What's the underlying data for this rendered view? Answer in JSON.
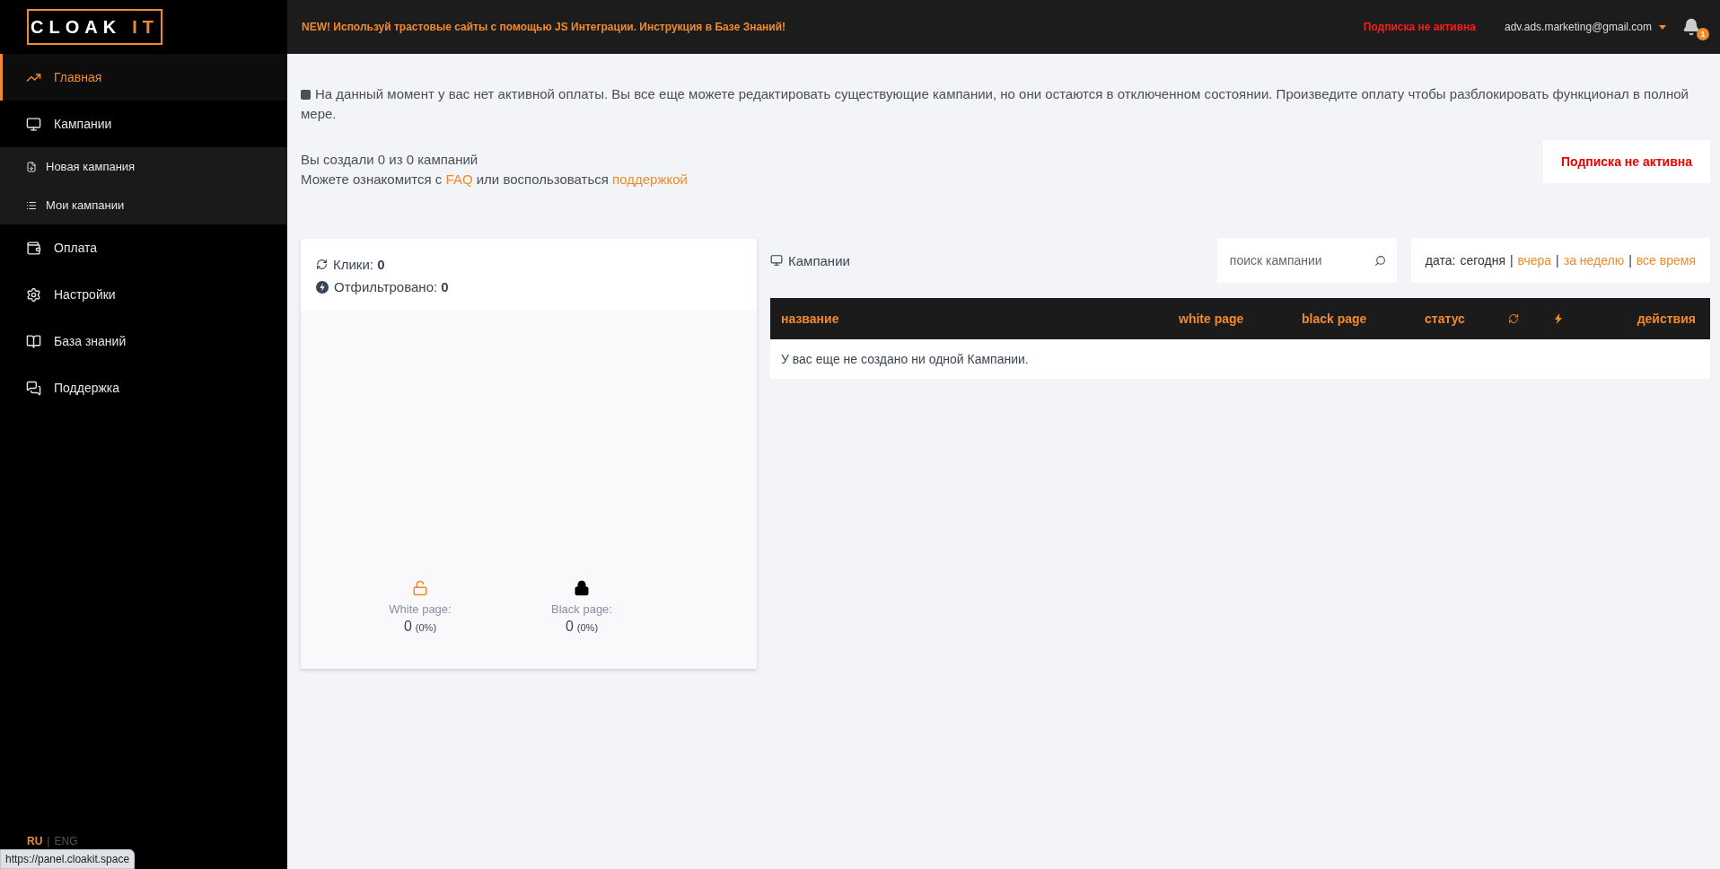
{
  "logo": {
    "word": "CLOAK",
    "accent": "IT"
  },
  "sidebar": {
    "items": [
      {
        "label": "Главная",
        "selected": true
      },
      {
        "label": "Кампании",
        "selected": false,
        "expanded": true,
        "children": [
          {
            "label": "Новая кампания",
            "selected": false
          },
          {
            "label": "Мои кампании",
            "selected": false
          }
        ]
      },
      {
        "label": "Оплата",
        "selected": false
      },
      {
        "label": "Настройки",
        "selected": false
      },
      {
        "label": "База знаний",
        "selected": false
      },
      {
        "label": "Поддержка",
        "selected": false
      }
    ],
    "languages": [
      {
        "label": "RU",
        "selected": true
      },
      {
        "label": "ENG",
        "selected": false
      }
    ],
    "language_separator": "|"
  },
  "topbar": {
    "announcement": "NEW! Используй трастовые сайты с помощью JS Интеграции. Инструкция в Базе Знаний!",
    "subscription_status": "Подписка не активна",
    "account": "adv.ads.marketing@gmail.com",
    "notifications_badge": "1"
  },
  "notice": "На данный момент у вас нет активной оплаты. Вы все еще можете редактировать существующие кампании, но они остаются в отключенном состоянии. Произведите оплату чтобы разблокировать функционал в полной мере.",
  "summary": {
    "created": "Вы создали 0 из 0 кампаний",
    "help_prefix": "Можете ознакомится с",
    "faq_link": "FAQ",
    "help_middle": "или воспользоваться",
    "support_link": "поддержкой"
  },
  "status_box": "Подписка не активна",
  "stats": {
    "clicks_label": "Клики:",
    "clicks": "0",
    "filtered_label": "Отфильтровано:",
    "filtered": "0",
    "pages": [
      {
        "kind": "white",
        "label": "White page:",
        "value": "0",
        "percent": "(0%)"
      },
      {
        "kind": "black",
        "label": "Black page:",
        "value": "0",
        "percent": "(0%)"
      }
    ]
  },
  "campaigns": {
    "title": "Кампании",
    "search": {
      "placeholder": "поиск кампании"
    },
    "date_filter": {
      "label": "дата:",
      "separator": "|",
      "options": [
        {
          "label": "сегодня",
          "selected": true
        },
        {
          "label": "вчера",
          "selected": false
        },
        {
          "label": "за неделю",
          "selected": false
        },
        {
          "label": "все время",
          "selected": false
        }
      ]
    },
    "columns": [
      {
        "kind": "text",
        "label": "название"
      },
      {
        "kind": "text",
        "label": "white page"
      },
      {
        "kind": "text",
        "label": "black page"
      },
      {
        "kind": "text",
        "label": "статус"
      },
      {
        "kind": "icon"
      },
      {
        "kind": "icon"
      },
      {
        "kind": "text",
        "label": "действия"
      }
    ],
    "empty_message": "У вас еще не создано ни одной Кампании."
  },
  "browser_status_url": "https://panel.cloakit.space"
}
